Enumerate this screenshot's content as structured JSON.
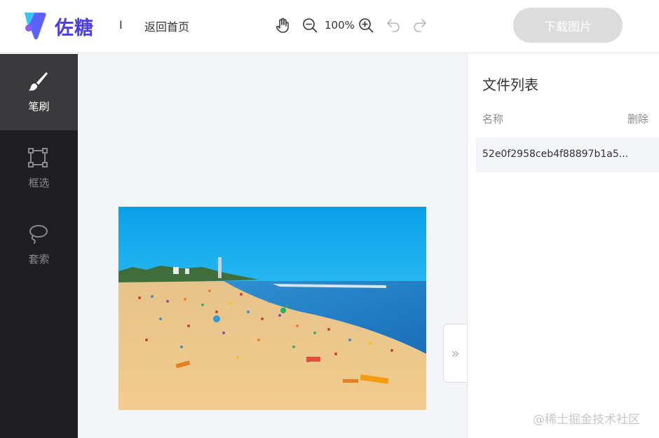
{
  "header": {
    "brand": "佐糖",
    "separator": "I",
    "home_link": "返回首页",
    "zoom_level": "100%",
    "download_label": "下载图片"
  },
  "sidebar": {
    "items": [
      {
        "label": "笔刷",
        "icon": "brush-icon",
        "active": true
      },
      {
        "label": "框选",
        "icon": "box-select-icon",
        "active": false
      },
      {
        "label": "套索",
        "icon": "lasso-icon",
        "active": false
      }
    ]
  },
  "file_panel": {
    "title": "文件列表",
    "col_name": "名称",
    "col_delete": "删除",
    "files": [
      {
        "name": "52e0f2958ceb4f88897b1a5..."
      }
    ]
  },
  "collapse_label": "»",
  "watermark": "@稀土掘金技术社区",
  "colors": {
    "brand": "#4b3fe0",
    "sidebar_bg": "#1f1f21",
    "sidebar_active": "#3a3a3d",
    "canvas_bg": "#f4f5f8",
    "download_btn": "#dcdcdc"
  }
}
